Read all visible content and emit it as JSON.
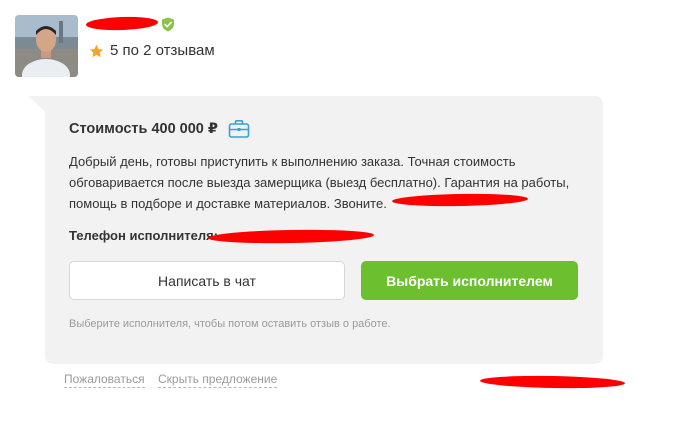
{
  "executor": {
    "rating_text": "5 по 2 отзывам",
    "verified_color": "#8bc34a",
    "star_color": "#f5a623"
  },
  "offer": {
    "price_label": "Стоимость 400 000 ₽",
    "description": "Добрый день, готовы приступить к выполнению заказа. Точная стоимость обговаривается после выезда замерщика (выезд бесплатно). Гарантия на работы, помощь в подборе и доставке материалов. Звоните.",
    "phone_label": "Телефон исполнителя:",
    "chat_button_label": "Написать в чат",
    "choose_button_label": "Выбрать исполнителем",
    "hint_text": "Выберите исполнителя, чтобы потом оставить отзыв о работе.",
    "accent_color": "#6cc02f",
    "card_background": "#f2f2f2"
  },
  "footer": {
    "complain_label": "Пожаловаться",
    "hide_label": "Скрыть предложение"
  },
  "icons": {
    "verified": "shield-check-icon",
    "star": "star-icon",
    "briefcase": "briefcase-icon"
  }
}
